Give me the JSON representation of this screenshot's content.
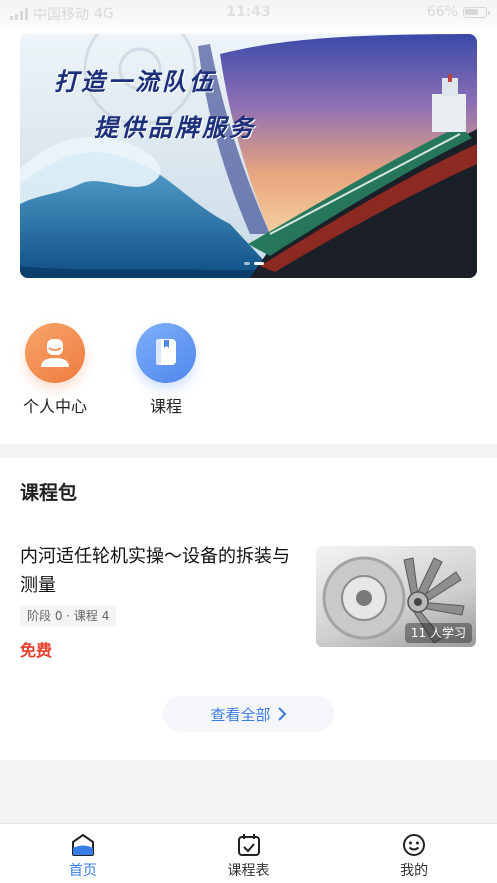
{
  "status_bar": {
    "carrier": "中国移动",
    "network": "4G",
    "time": "11:43",
    "battery": "66%",
    "battery_level": 0.66
  },
  "banner": {
    "slogan_line1": "打造一流队伍",
    "slogan_line2": "提供品牌服务",
    "slide_count": 2,
    "active_slide": 2
  },
  "quick_entries": [
    {
      "label": "个人中心",
      "icon": "user-icon"
    },
    {
      "label": "课程",
      "icon": "book-icon"
    }
  ],
  "course_package": {
    "section_title": "课程包",
    "item": {
      "title": "内河适任轮机实操～设备的拆装与测量",
      "meta": "阶段 0 · 课程 4",
      "price": "免费",
      "learners": "11 人学习"
    },
    "view_all": "查看全部"
  },
  "tab_bar": {
    "tabs": [
      {
        "label": "首页",
        "icon": "home-icon",
        "active": true
      },
      {
        "label": "课程表",
        "icon": "calendar-check-icon",
        "active": false
      },
      {
        "label": "我的",
        "icon": "smiley-icon",
        "active": false
      }
    ]
  },
  "colors": {
    "accent": "#3a7ce6",
    "price": "#e5402f",
    "profile_icon": "#ef7c3f",
    "course_icon": "#4f86ec"
  }
}
